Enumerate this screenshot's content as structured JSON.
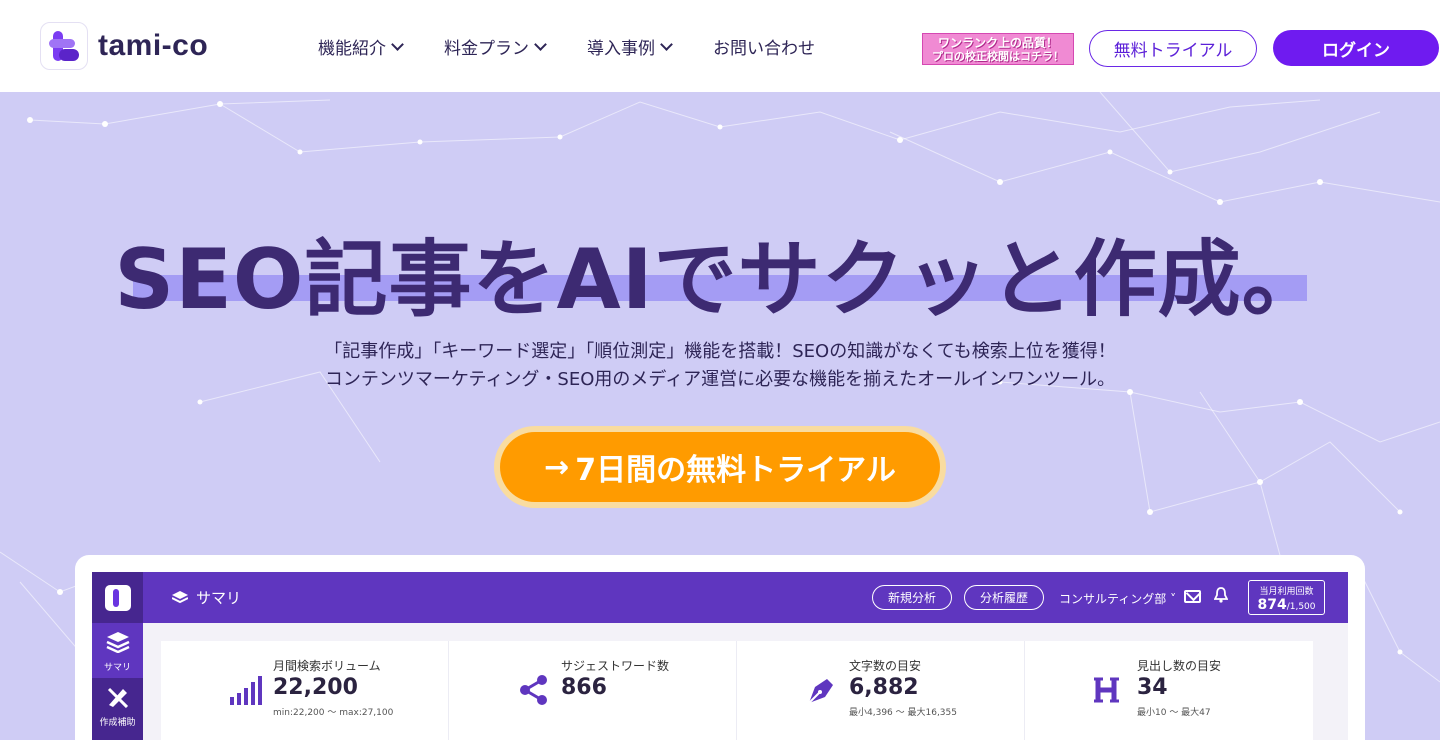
{
  "header": {
    "logo_text": "tami-co",
    "nav": [
      {
        "label": "機能紹介",
        "dropdown": true
      },
      {
        "label": "料金プラン",
        "dropdown": true
      },
      {
        "label": "導入事例",
        "dropdown": true
      },
      {
        "label": "お問い合わせ",
        "dropdown": false
      }
    ],
    "banner_line1": "ワンランク上の品質！",
    "banner_line2": "プロの校正校閲はコチラ！",
    "trial_button": "無料トライアル",
    "login_button": "ログイン"
  },
  "hero": {
    "title": "SEO記事をAIでサクッと作成。",
    "sub_line1": "「記事作成」「キーワード選定」「順位測定」機能を搭載！SEOの知識がなくても検索上位を獲得！",
    "sub_line2": "コンテンツマーケティング・SEO用のメディア運営に必要な機能を揃えたオールインワンツール。",
    "cta": "7日間の無料トライアル",
    "cta_arrow": "→"
  },
  "dashboard": {
    "page_title": "サマリ",
    "new_analysis": "新規分析",
    "history": "分析履歴",
    "department": "コンサルティング部",
    "usage_label": "当月利用回数",
    "usage_value": "874",
    "usage_limit": "/1,500",
    "sidebar": [
      {
        "label": "サマリ",
        "icon": "layers-icon"
      },
      {
        "label": "作成補助",
        "icon": "pencil-ruler-icon"
      }
    ],
    "stats": [
      {
        "label": "月間検索ボリューム",
        "value": "22,200",
        "note": "min:22,200 〜 max:27,100",
        "icon": "signal-bars-icon"
      },
      {
        "label": "サジェストワード数",
        "value": "866",
        "note": "",
        "icon": "share-icon"
      },
      {
        "label": "文字数の目安",
        "value": "6,882",
        "note": "最小4,396 〜 最大16,355",
        "icon": "pen-nib-icon"
      },
      {
        "label": "見出し数の目安",
        "value": "34",
        "note": "最小10 〜 最大47",
        "icon": "heading-icon"
      }
    ]
  },
  "colors": {
    "brand": "#6f1bf0",
    "hero_bg": "#cfccf5",
    "cta": "#ff9b00",
    "title": "#3d2a72",
    "app_header": "#5f36bf"
  }
}
